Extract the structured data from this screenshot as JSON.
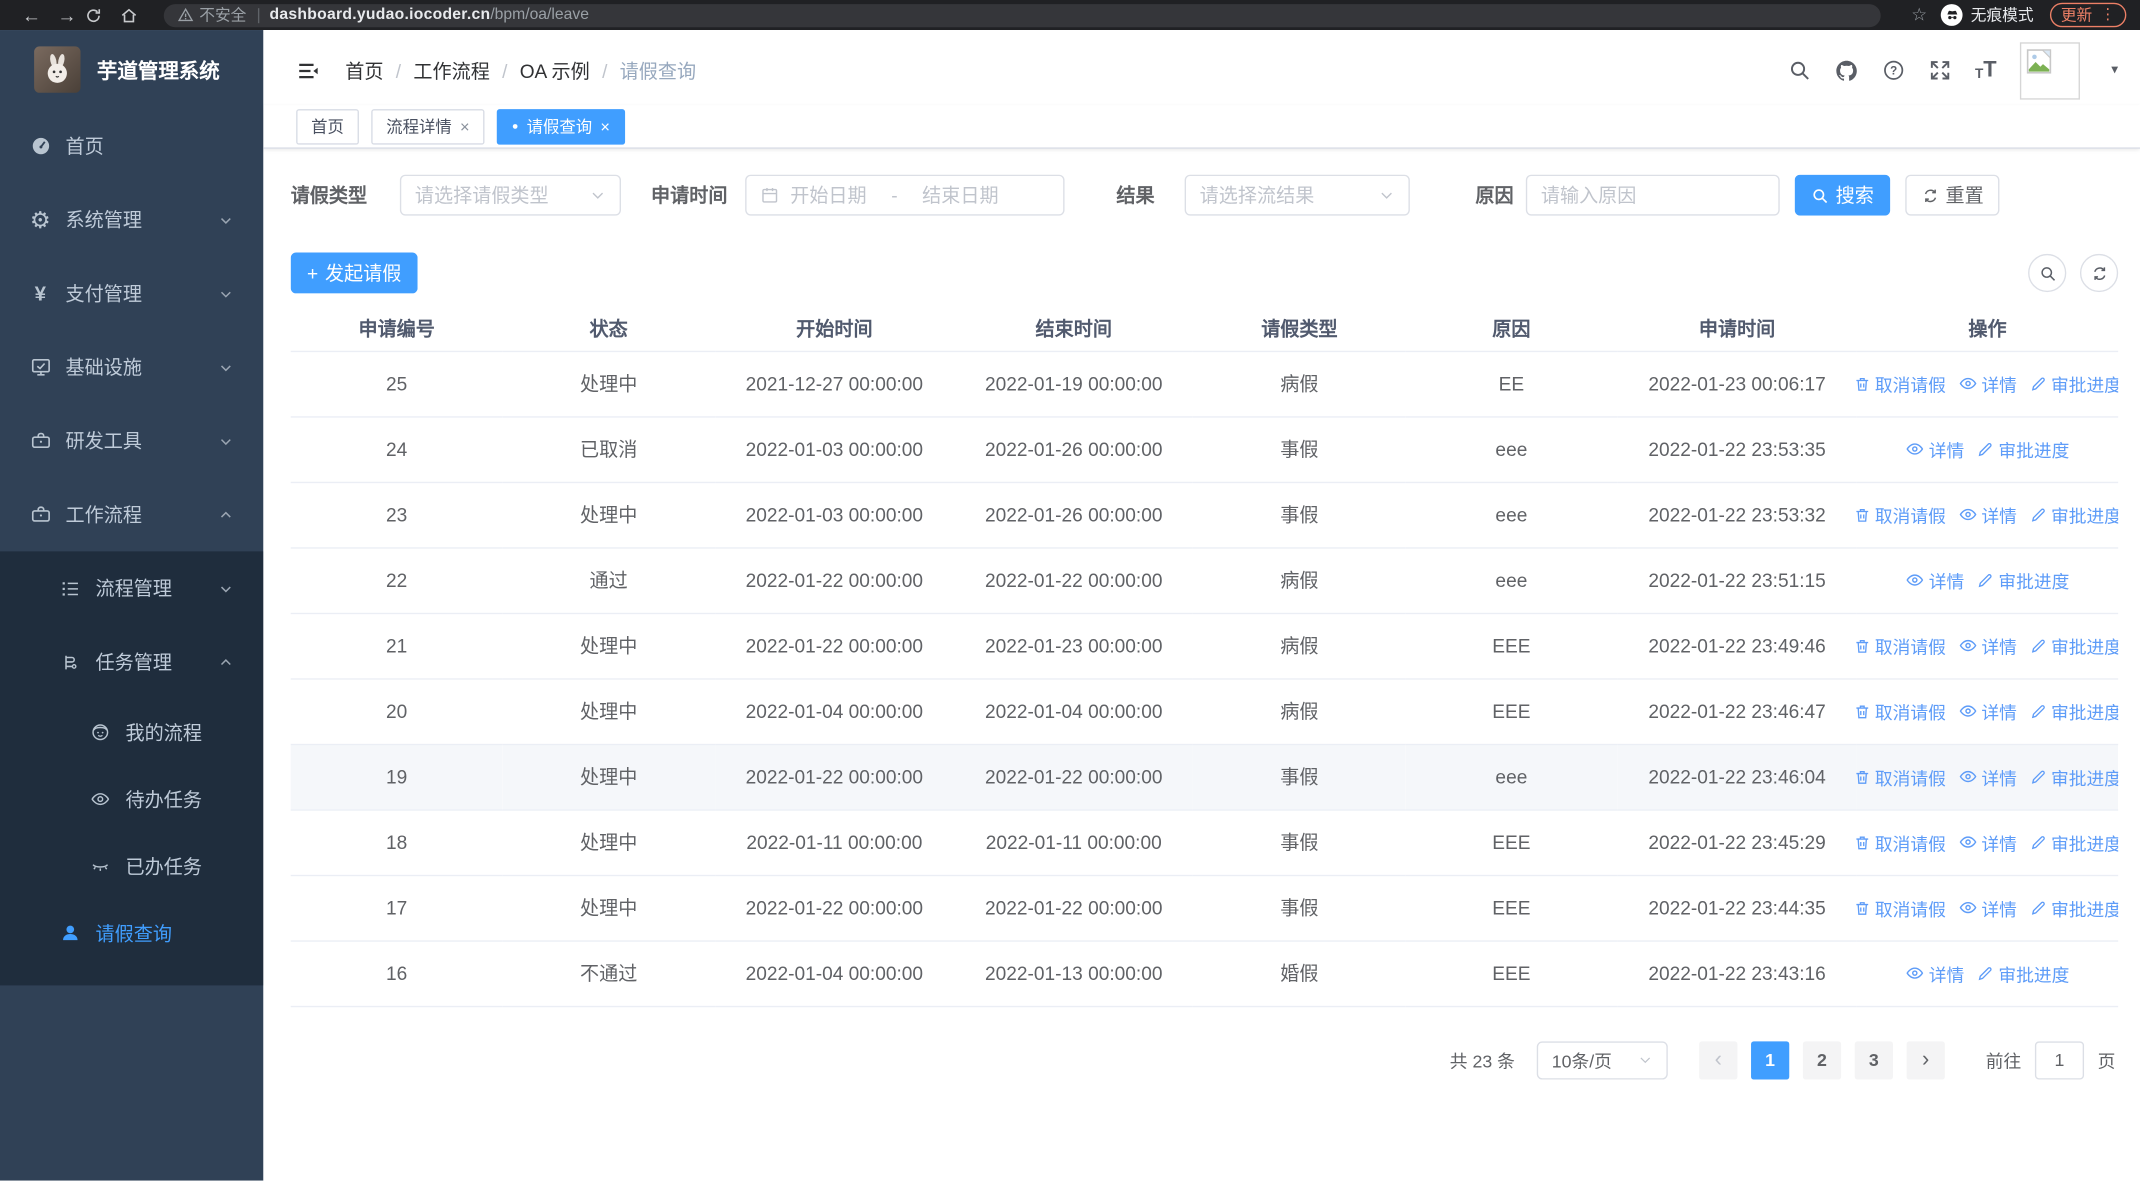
{
  "glyphs": {
    "back": "←",
    "forward": "→",
    "star": "☆",
    "kebab": "⋮",
    "menu_dot": "●",
    "close": "×",
    "caret_down": "▾",
    "prev": "‹",
    "next": "›",
    "plus": "+",
    "yen": "¥",
    "gear": "⚙",
    "question": "?",
    "slash": "/",
    "text_size_small": "T",
    "text_size_big": "T"
  },
  "browser": {
    "security_label": "不安全",
    "url_host": "dashboard.yudao.iocoder.cn",
    "url_path": "/bpm/oa/leave",
    "incognito_label": "无痕模式",
    "update_label": "更新"
  },
  "sidebar": {
    "title": "芋道管理系统",
    "menu": [
      {
        "label": "首页"
      },
      {
        "label": "系统管理"
      },
      {
        "label": "支付管理"
      },
      {
        "label": "基础设施"
      },
      {
        "label": "研发工具"
      },
      {
        "label": "工作流程"
      }
    ],
    "workflow_children": [
      {
        "label": "流程管理"
      },
      {
        "label": "任务管理"
      }
    ],
    "task_children": [
      {
        "label": "我的流程"
      },
      {
        "label": "待办任务"
      },
      {
        "label": "已办任务"
      }
    ],
    "active_item": {
      "label": "请假查询"
    }
  },
  "header": {
    "breadcrumb": [
      "首页",
      "工作流程",
      "OA 示例",
      "请假查询"
    ]
  },
  "tags": [
    {
      "label": "首页"
    },
    {
      "label": "流程详情"
    },
    {
      "label": "请假查询"
    }
  ],
  "filters": {
    "leave_type_label": "请假类型",
    "leave_type_placeholder": "请选择请假类型",
    "apply_time_label": "申请时间",
    "start_placeholder": "开始日期",
    "range_separator": "-",
    "end_placeholder": "结束日期",
    "result_label": "结果",
    "result_placeholder": "请选择流结果",
    "reason_label": "原因",
    "reason_placeholder": "请输入原因",
    "search_label": "搜索",
    "reset_label": "重置"
  },
  "toolbar": {
    "create_label": "发起请假"
  },
  "table": {
    "headers": [
      "申请编号",
      "状态",
      "开始时间",
      "结束时间",
      "请假类型",
      "原因",
      "申请时间",
      "操作"
    ],
    "action_labels": {
      "cancel": "取消请假",
      "detail": "详情",
      "progress": "审批进度"
    },
    "rows": [
      {
        "id": "25",
        "status": "处理中",
        "start": "2021-12-27 00:00:00",
        "end": "2022-01-19 00:00:00",
        "type": "病假",
        "reason": "EE",
        "applied": "2022-01-23 00:06:17",
        "cancel": true,
        "highlight": false
      },
      {
        "id": "24",
        "status": "已取消",
        "start": "2022-01-03 00:00:00",
        "end": "2022-01-26 00:00:00",
        "type": "事假",
        "reason": "eee",
        "applied": "2022-01-22 23:53:35",
        "cancel": false,
        "highlight": false
      },
      {
        "id": "23",
        "status": "处理中",
        "start": "2022-01-03 00:00:00",
        "end": "2022-01-26 00:00:00",
        "type": "事假",
        "reason": "eee",
        "applied": "2022-01-22 23:53:32",
        "cancel": true,
        "highlight": false
      },
      {
        "id": "22",
        "status": "通过",
        "start": "2022-01-22 00:00:00",
        "end": "2022-01-22 00:00:00",
        "type": "病假",
        "reason": "eee",
        "applied": "2022-01-22 23:51:15",
        "cancel": false,
        "highlight": false
      },
      {
        "id": "21",
        "status": "处理中",
        "start": "2022-01-22 00:00:00",
        "end": "2022-01-23 00:00:00",
        "type": "病假",
        "reason": "EEE",
        "applied": "2022-01-22 23:49:46",
        "cancel": true,
        "highlight": false
      },
      {
        "id": "20",
        "status": "处理中",
        "start": "2022-01-04 00:00:00",
        "end": "2022-01-04 00:00:00",
        "type": "病假",
        "reason": "EEE",
        "applied": "2022-01-22 23:46:47",
        "cancel": true,
        "highlight": false
      },
      {
        "id": "19",
        "status": "处理中",
        "start": "2022-01-22 00:00:00",
        "end": "2022-01-22 00:00:00",
        "type": "事假",
        "reason": "eee",
        "applied": "2022-01-22 23:46:04",
        "cancel": true,
        "highlight": true
      },
      {
        "id": "18",
        "status": "处理中",
        "start": "2022-01-11 00:00:00",
        "end": "2022-01-11 00:00:00",
        "type": "事假",
        "reason": "EEE",
        "applied": "2022-01-22 23:45:29",
        "cancel": true,
        "highlight": false
      },
      {
        "id": "17",
        "status": "处理中",
        "start": "2022-01-22 00:00:00",
        "end": "2022-01-22 00:00:00",
        "type": "事假",
        "reason": "EEE",
        "applied": "2022-01-22 23:44:35",
        "cancel": true,
        "highlight": false
      },
      {
        "id": "16",
        "status": "不通过",
        "start": "2022-01-04 00:00:00",
        "end": "2022-01-13 00:00:00",
        "type": "婚假",
        "reason": "EEE",
        "applied": "2022-01-22 23:43:16",
        "cancel": false,
        "highlight": false
      }
    ]
  },
  "pagination": {
    "total": "共 23 条",
    "page_size": "10条/页",
    "pages": [
      "1",
      "2",
      "3"
    ],
    "goto_label": "前往",
    "goto_value": "1",
    "page_unit": "页"
  },
  "colors": {
    "primary": "#409eff",
    "sidebar_bg": "#304156",
    "submenu_bg": "#1f2d3d",
    "update_accent": "#ed8066"
  }
}
